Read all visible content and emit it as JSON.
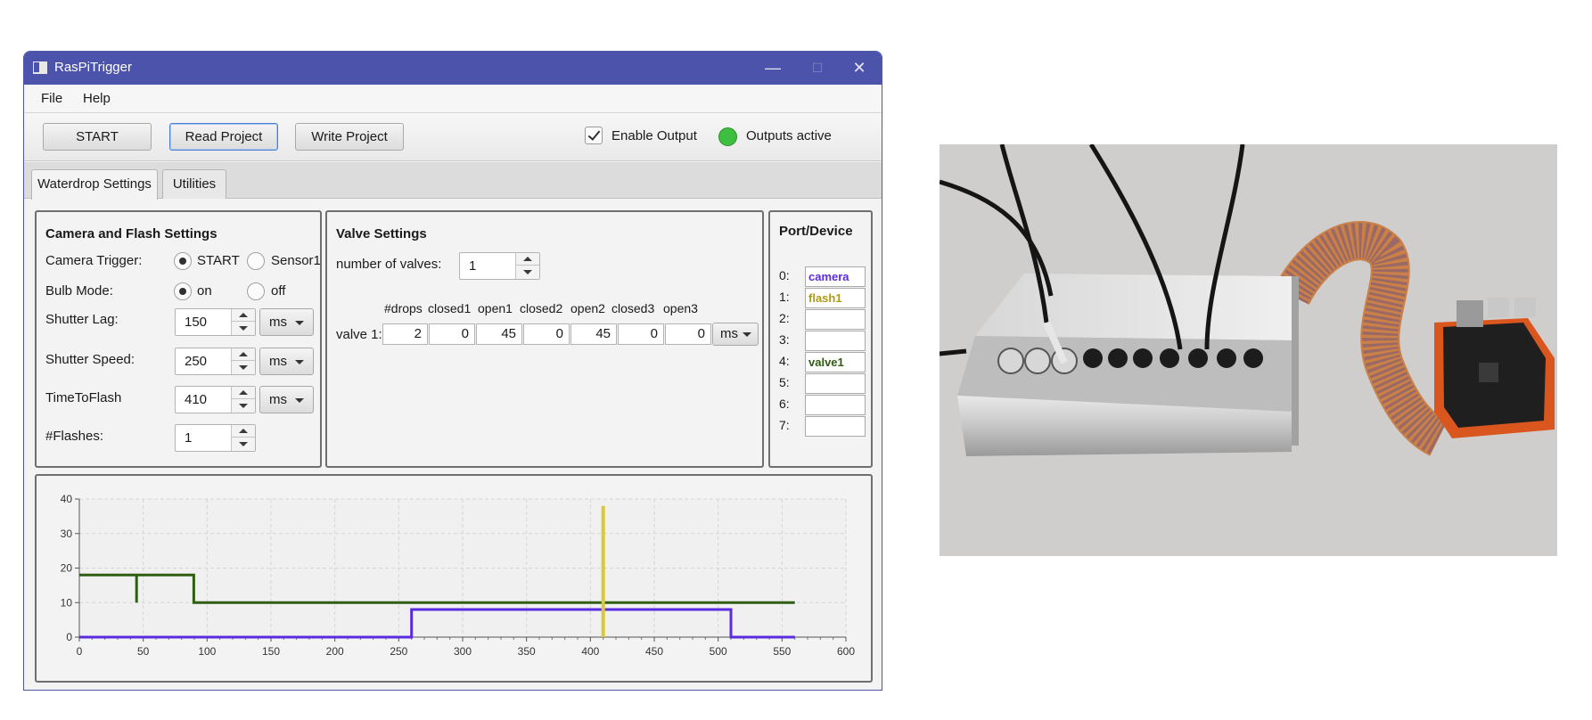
{
  "window": {
    "title": "RasPiTrigger",
    "minimize_glyph": "—",
    "maximize_glyph": "☐",
    "close_glyph": "✕"
  },
  "menu": {
    "file": "File",
    "help": "Help"
  },
  "toolbar": {
    "start": "START",
    "read_project": "Read Project",
    "write_project": "Write Project",
    "enable_output": "Enable Output",
    "outputs_active": "Outputs active",
    "led_color": "#3fbf3f"
  },
  "tabs": {
    "waterdrop": "Waterdrop Settings",
    "utilities": "Utilities"
  },
  "camera": {
    "title": "Camera and Flash Settings",
    "camera_trigger_label": "Camera Trigger:",
    "trigger_start": "START",
    "trigger_sensor1": "Sensor1",
    "bulb_mode_label": "Bulb Mode:",
    "bulb_on": "on",
    "bulb_off": "off",
    "shutter_lag_label": "Shutter Lag:",
    "shutter_lag_value": "150",
    "shutter_lag_unit": "ms",
    "shutter_speed_label": "Shutter Speed:",
    "shutter_speed_value": "250",
    "shutter_speed_unit": "ms",
    "time_to_flash_label": "TimeToFlash",
    "time_to_flash_value": "410",
    "time_to_flash_unit": "ms",
    "flashes_label": "#Flashes:",
    "flashes_value": "1"
  },
  "valve": {
    "title": "Valve Settings",
    "num_valves_label": "number of valves:",
    "num_valves_value": "1",
    "headers": [
      "#drops",
      "closed1",
      "open1",
      "closed2",
      "open2",
      "closed3",
      "open3"
    ],
    "row_label": "valve 1:",
    "values": [
      "2",
      "0",
      "45",
      "0",
      "45",
      "0",
      "0"
    ],
    "unit": "ms"
  },
  "ports": {
    "title": "Port/Device",
    "items": [
      {
        "label": "0:",
        "device": "camera",
        "color": "#5a2be0"
      },
      {
        "label": "1:",
        "device": "flash1",
        "color": "#b09a10"
      },
      {
        "label": "2:",
        "device": "",
        "color": "#000000"
      },
      {
        "label": "3:",
        "device": "",
        "color": "#000000"
      },
      {
        "label": "4:",
        "device": "valve1",
        "color": "#2f5e12"
      },
      {
        "label": "5:",
        "device": "",
        "color": "#000000"
      },
      {
        "label": "6:",
        "device": "",
        "color": "#000000"
      },
      {
        "label": "7:",
        "device": "",
        "color": "#000000"
      }
    ]
  },
  "chart_data": {
    "type": "line",
    "xlim": [
      0,
      600
    ],
    "ylim": [
      0,
      40
    ],
    "xticks": [
      0,
      50,
      100,
      150,
      200,
      250,
      300,
      350,
      400,
      450,
      500,
      550,
      600
    ],
    "yticks": [
      0,
      10,
      20,
      30,
      40
    ],
    "grid": true,
    "series": [
      {
        "color": "#2f5e12",
        "points": [
          [
            0,
            18
          ],
          [
            44.8,
            18
          ],
          [
            44.8,
            10
          ],
          [
            44.8,
            18
          ],
          [
            89.6,
            18
          ],
          [
            89.6,
            10
          ],
          [
            560,
            10
          ]
        ]
      },
      {
        "color": "#5a2be0",
        "points": [
          [
            0,
            0
          ],
          [
            260,
            0
          ],
          [
            260,
            8
          ],
          [
            510,
            8
          ],
          [
            510,
            0
          ],
          [
            560,
            0
          ]
        ]
      },
      {
        "color": "#d8c83a",
        "points": [
          [
            410,
            0
          ],
          [
            410,
            38
          ]
        ]
      }
    ]
  }
}
